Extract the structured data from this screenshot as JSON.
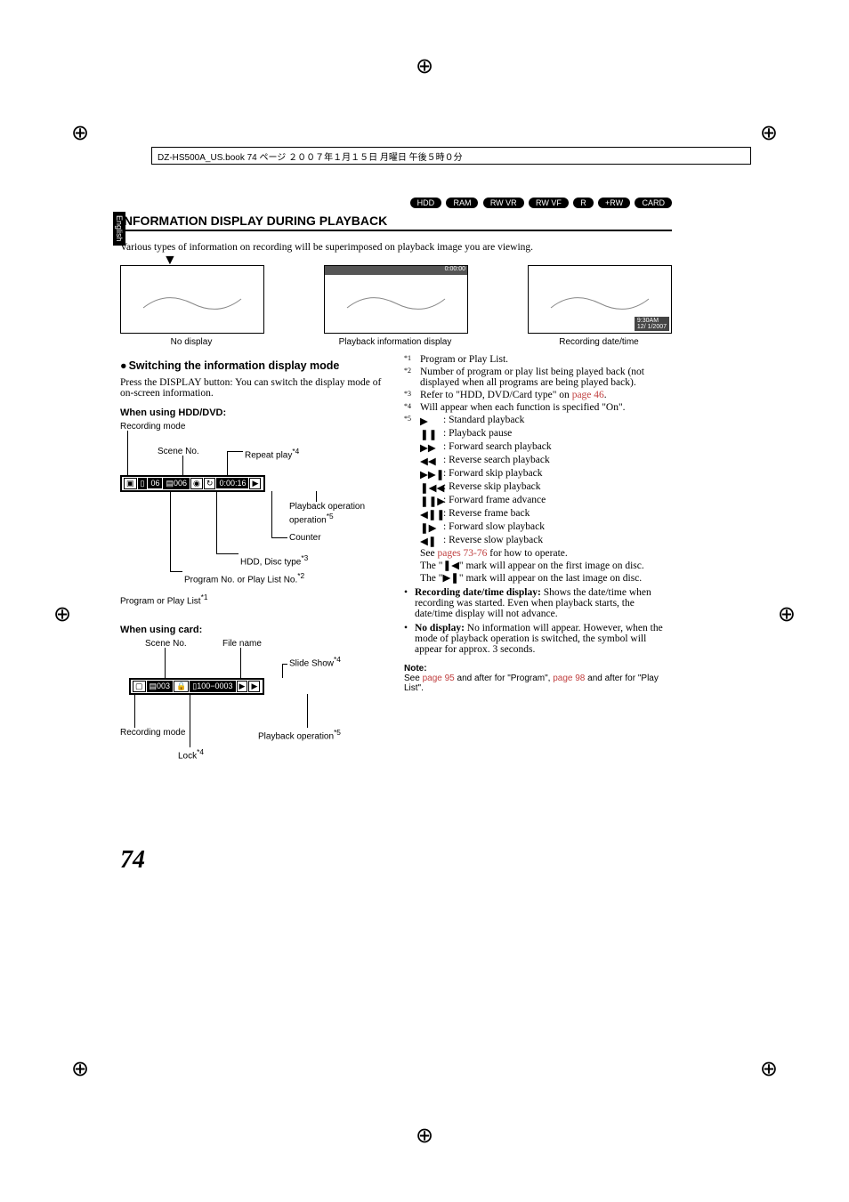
{
  "header_text": "DZ-HS500A_US.book  74 ページ  ２００７年１月１５日  月曜日  午後５時０分",
  "side_tab": "English",
  "badges": [
    "HDD",
    "RAM",
    "RW VR",
    "RW VF",
    "R",
    "+RW",
    "CARD"
  ],
  "section_title": "INFORMATION DISPLAY DURING PLAYBACK",
  "intro": "Various types of information on recording will be superimposed on playback image you are viewing.",
  "screens": {
    "cap1": "No display",
    "cap2": "Playback information display",
    "cap3": "Recording date/time",
    "rec_time": "9:30AM",
    "rec_date": "12/ 1/2007",
    "mid_bar": "0:00:00"
  },
  "subhead": "Switching the information display mode",
  "subbody": "Press the DISPLAY button: You can switch the display mode of on-screen information.",
  "when1": "When using HDD/DVD:",
  "when2": "When using card:",
  "dvd_labels": {
    "recmode": "Recording mode",
    "sceneno": "Scene No.",
    "repeat": "Repeat play",
    "repeat_sup": "*4",
    "playback_op": "Playback operation",
    "playback_op_sup": "*5",
    "counter": "Counter",
    "disctype": "HDD, Disc type",
    "disctype_sup": "*3",
    "progno": "Program No. or Play List No.",
    "progno_sup": "*2",
    "progplay": "Program or Play List",
    "progplay_sup": "*1",
    "seg_time": "0:00:16",
    "seg_prog": "06",
    "seg_scene": "006"
  },
  "card_labels": {
    "sceneno": "Scene No.",
    "filename": "File name",
    "slideshow": "Slide Show",
    "slideshow_sup": "*4",
    "recmode": "Recording mode",
    "lock": "Lock",
    "lock_sup": "*4",
    "playback_op": "Playback operation",
    "playback_op_sup": "*5",
    "seg_scene": "003",
    "seg_file": "100−0003"
  },
  "footnotes": {
    "f1": " Program or  Play List.",
    "f2": "Number of program or play list being played back (not displayed when all programs are being played back).",
    "f3_a": "Refer to \"HDD, DVD/Card type\" on ",
    "f3_link": "page 46",
    "f3_b": ".",
    "f4": "Will appear when each function is specified \"On\"."
  },
  "icons": [
    {
      "sym": "▶",
      "txt": ": Standard playback"
    },
    {
      "sym": "❚❚",
      "txt": ": Playback pause"
    },
    {
      "sym": "▶▶",
      "txt": ": Forward search playback"
    },
    {
      "sym": "◀◀",
      "txt": ": Reverse search playback"
    },
    {
      "sym": "▶▶❚",
      "txt": ": Forward skip playback"
    },
    {
      "sym": "❚◀◀",
      "txt": ": Reverse skip playback"
    },
    {
      "sym": "❚❚▶",
      "txt": ": Forward frame advance"
    },
    {
      "sym": "◀❚❚",
      "txt": ": Reverse frame back"
    },
    {
      "sym": "❚▶",
      "txt": ": Forward slow playback"
    },
    {
      "sym": "◀❚",
      "txt": ": Reverse slow playback"
    }
  ],
  "f5_tail": {
    "see_a": "See ",
    "see_link": "pages 73-76",
    "see_b": " for how to operate.",
    "first": "The \"❚◀\" mark will appear on the first image on disc.",
    "last": "The \"▶❚\" mark will appear on the last image on disc."
  },
  "bul1_a": "Recording date/time display:",
  "bul1_b": " Shows the date/time when recording was started. Even when playback starts, the date/time display will not advance.",
  "bul2_a": "No display:",
  "bul2_b": " No information will appear. However, when the mode of playback operation is switched, the symbol will appear for approx. 3 seconds.",
  "note_h": "Note:",
  "note_a": "See ",
  "note_l1": "page 95",
  "note_b": " and after for \"Program\", ",
  "note_l2": "page 98",
  "note_c": " and after for \"Play List\".",
  "pagenum": "74"
}
